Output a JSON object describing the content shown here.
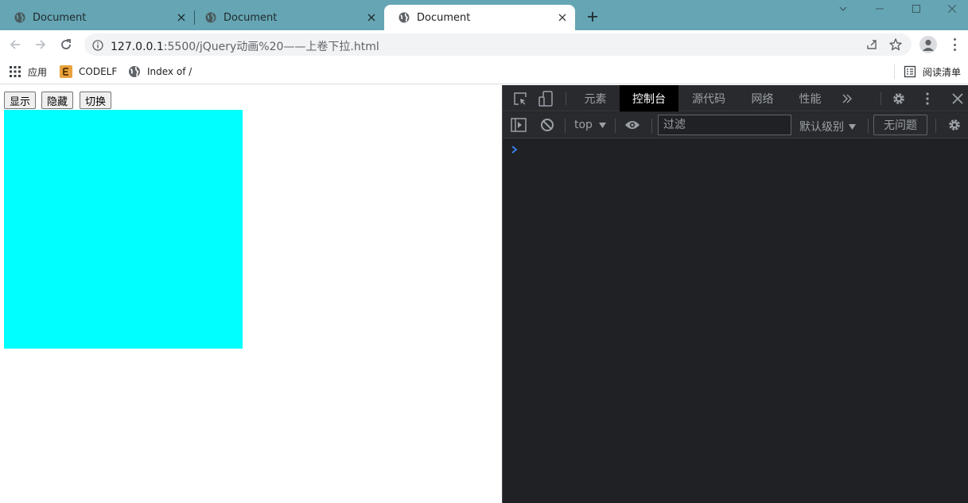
{
  "browser": {
    "tabs": [
      {
        "title": "Document",
        "active": false
      },
      {
        "title": "Document",
        "active": false
      },
      {
        "title": "Document",
        "active": true
      }
    ],
    "address": {
      "url_host": "127.0.0.1",
      "url_rest": ":5500/jQuery动画%20——上卷下拉.html"
    },
    "bookmarks": [
      {
        "label": "应用",
        "icon": "apps-grid-icon"
      },
      {
        "label": "CODELF",
        "icon": "codelf-icon"
      },
      {
        "label": "Index of /",
        "icon": "globe-icon"
      }
    ],
    "reading_list": "阅读清单"
  },
  "page": {
    "buttons": {
      "show": "显示",
      "hide": "隐藏",
      "toggle": "切换"
    },
    "box_color": "#00ffff"
  },
  "devtools": {
    "tabs": [
      "元素",
      "控制台",
      "源代码",
      "网络",
      "性能"
    ],
    "active_tab": "控制台",
    "context": "top",
    "filter_placeholder": "过滤",
    "log_level": "默认级别",
    "issues": "无问题"
  },
  "colors": {
    "tabstrip": "#66a5b3",
    "devtools_bg": "#202124",
    "prompt_accent": "#3b82f6"
  }
}
